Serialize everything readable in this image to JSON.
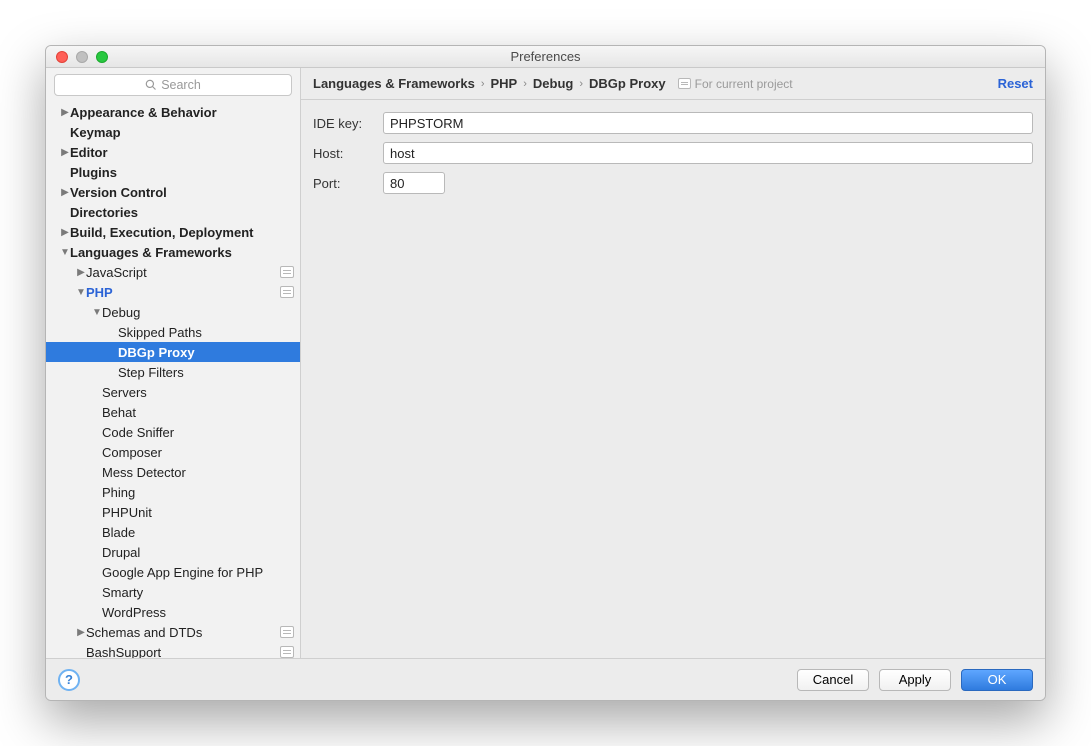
{
  "window_title": "Preferences",
  "search": {
    "placeholder": "Search"
  },
  "sidebar": {
    "items": [
      {
        "label": "Appearance & Behavior",
        "bold": true,
        "arrow": "right",
        "indent": 0
      },
      {
        "label": "Keymap",
        "bold": true,
        "arrow": "none",
        "indent": 0
      },
      {
        "label": "Editor",
        "bold": true,
        "arrow": "right",
        "indent": 0
      },
      {
        "label": "Plugins",
        "bold": true,
        "arrow": "none",
        "indent": 0
      },
      {
        "label": "Version Control",
        "bold": true,
        "arrow": "right",
        "indent": 0
      },
      {
        "label": "Directories",
        "bold": true,
        "arrow": "none",
        "indent": 0
      },
      {
        "label": "Build, Execution, Deployment",
        "bold": true,
        "arrow": "right",
        "indent": 0
      },
      {
        "label": "Languages & Frameworks",
        "bold": true,
        "arrow": "down",
        "indent": 0
      },
      {
        "label": "JavaScript",
        "arrow": "right",
        "indent": 1,
        "badge": true
      },
      {
        "label": "PHP",
        "arrow": "down",
        "indent": 1,
        "badge": true,
        "blue": true
      },
      {
        "label": "Debug",
        "arrow": "down",
        "indent": 2
      },
      {
        "label": "Skipped Paths",
        "arrow": "none",
        "indent": 3
      },
      {
        "label": "DBGp Proxy",
        "arrow": "none",
        "indent": 3,
        "selected": true
      },
      {
        "label": "Step Filters",
        "arrow": "none",
        "indent": 3
      },
      {
        "label": "Servers",
        "arrow": "none",
        "indent": 2
      },
      {
        "label": "Behat",
        "arrow": "none",
        "indent": 2
      },
      {
        "label": "Code Sniffer",
        "arrow": "none",
        "indent": 2
      },
      {
        "label": "Composer",
        "arrow": "none",
        "indent": 2
      },
      {
        "label": "Mess Detector",
        "arrow": "none",
        "indent": 2
      },
      {
        "label": "Phing",
        "arrow": "none",
        "indent": 2
      },
      {
        "label": "PHPUnit",
        "arrow": "none",
        "indent": 2
      },
      {
        "label": "Blade",
        "arrow": "none",
        "indent": 2
      },
      {
        "label": "Drupal",
        "arrow": "none",
        "indent": 2
      },
      {
        "label": "Google App Engine for PHP",
        "arrow": "none",
        "indent": 2
      },
      {
        "label": "Smarty",
        "arrow": "none",
        "indent": 2
      },
      {
        "label": "WordPress",
        "arrow": "none",
        "indent": 2
      },
      {
        "label": "Schemas and DTDs",
        "arrow": "right",
        "indent": 1,
        "badge": true
      },
      {
        "label": "BashSupport",
        "arrow": "none",
        "indent": 1,
        "badge": true
      }
    ]
  },
  "breadcrumb": {
    "parts": [
      "Languages & Frameworks",
      "PHP",
      "Debug",
      "DBGp Proxy"
    ],
    "note": "For current project",
    "reset": "Reset"
  },
  "form": {
    "ide_key_label": "IDE key:",
    "ide_key_value": "PHPSTORM",
    "host_label": "Host:",
    "host_value": "host",
    "port_label": "Port:",
    "port_value": "80"
  },
  "footer": {
    "help": "?",
    "cancel": "Cancel",
    "apply": "Apply",
    "ok": "OK"
  }
}
